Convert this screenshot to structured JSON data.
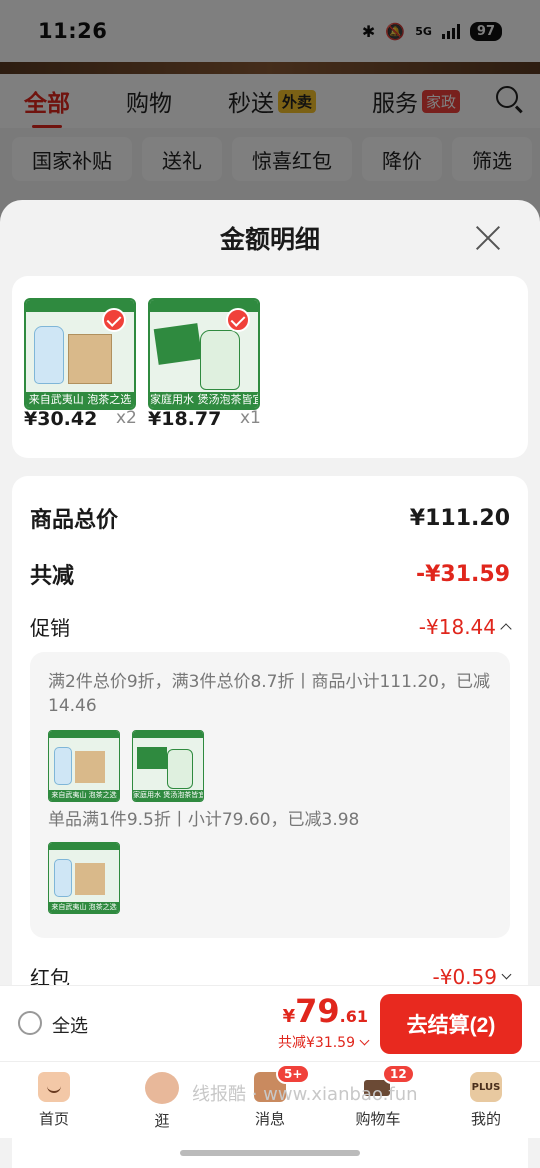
{
  "status_bar": {
    "time": "11:26",
    "network": "5G",
    "battery": "97"
  },
  "background": {
    "tabs": [
      {
        "label": "全部",
        "tag": ""
      },
      {
        "label": "购物",
        "tag": ""
      },
      {
        "label": "秒送",
        "tag": "外卖"
      },
      {
        "label": "服务",
        "tag": "家政"
      }
    ],
    "filters": [
      "国家补贴",
      "送礼",
      "惊喜红包",
      "降价",
      "筛选"
    ]
  },
  "sheet": {
    "title": "金额明细",
    "products": [
      {
        "price": "¥30.42",
        "qty": "x2",
        "caption": "来自武夷山 泡茶之选"
      },
      {
        "price": "¥18.77",
        "qty": "x1",
        "caption": "家庭用水 煲汤泡茶皆宜"
      }
    ],
    "rows": {
      "total_label": "商品总价",
      "total_value": "¥111.20",
      "discount_label": "共减",
      "discount_value": "-¥31.59",
      "promo_label": "促销",
      "promo_value": "-¥18.44",
      "redpacket_label": "红包",
      "redpacket_value": "-¥0.59"
    },
    "promo_detail": {
      "rule1": "满2件总价9折，满3件总价8.7折丨商品小计111.20，已减14.46",
      "rule2": "单品满1件9.5折丨小计79.60，已减3.98",
      "thumb_captions": [
        "来自武夷山 泡茶之选",
        "家庭用水 煲汤泡茶皆宜",
        "来自武夷山 泡茶之选"
      ]
    }
  },
  "checkout": {
    "select_all": "全选",
    "currency": "¥",
    "total_int": "79",
    "total_dec": ".61",
    "reduced": "共减¥31.59",
    "button": "去结算(2)"
  },
  "tab_bar": {
    "items": [
      {
        "label": "首页",
        "badge": ""
      },
      {
        "label": "逛",
        "badge": ""
      },
      {
        "label": "消息",
        "badge": "5+"
      },
      {
        "label": "购物车",
        "badge": "12"
      },
      {
        "label": "我的",
        "badge": ""
      }
    ],
    "plus_text": "PLUS"
  },
  "watermark": "线报酷 · www.xianbao.fun"
}
